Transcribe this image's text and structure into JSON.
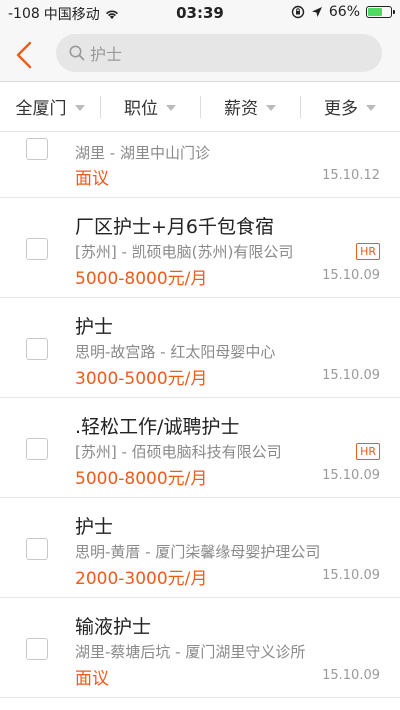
{
  "status_bar": {
    "signal": "-108",
    "carrier": "中国移动",
    "time": "03:39",
    "battery": "66%",
    "battery_level": 0.66,
    "battery_color": "#4cd964"
  },
  "header": {
    "back_icon": "chevron-left-icon",
    "search_placeholder": "护士",
    "accent_color": "#f25a1b"
  },
  "filters": [
    {
      "label": "全厦门"
    },
    {
      "label": "职位"
    },
    {
      "label": "薪资"
    },
    {
      "label": "更多"
    }
  ],
  "jobs": [
    {
      "title": "",
      "company": "湖里 - 湖里中山门诊",
      "salary": "面议",
      "date": "15.10.12",
      "hr": ""
    },
    {
      "title": "厂区护士+月6千包食宿",
      "company": "[苏州] - 凯硕电脑(苏州)有限公司",
      "salary": "5000-8000元/月",
      "date": "15.10.09",
      "hr": "HR"
    },
    {
      "title": "护士",
      "company": "思明-故宫路 - 红太阳母婴中心",
      "salary": "3000-5000元/月",
      "date": "15.10.09",
      "hr": ""
    },
    {
      "title": ".轻松工作/诚聘护士",
      "company": "[苏州] - 佰硕电脑科技有限公司",
      "salary": "5000-8000元/月",
      "date": "15.10.09",
      "hr": "HR"
    },
    {
      "title": "护士",
      "company": "思明-黄厝 - 厦门柒馨缘母婴护理公司",
      "salary": "2000-3000元/月",
      "date": "15.10.09",
      "hr": ""
    },
    {
      "title": "输液护士",
      "company": "湖里-蔡塘后坑 - 厦门湖里守义诊所",
      "salary": "面议",
      "date": "15.10.09",
      "hr": ""
    }
  ]
}
